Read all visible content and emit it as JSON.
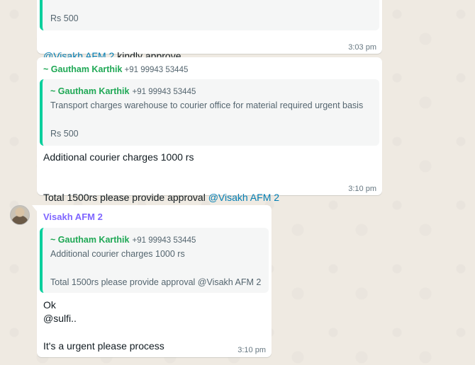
{
  "chat": {
    "msg1": {
      "quote_amount": "Rs 500",
      "mention": "@Visakh AFM 2",
      "text": " kindly approve",
      "time": "3:03 pm"
    },
    "msg2": {
      "sender_name": "~ Gautham Karthik",
      "sender_phone": "+91 99943 53445",
      "quote_author": "~ Gautham Karthik",
      "quote_phone": "+91 99943 53445",
      "quote_text": "Transport charges warehouse to courier office for material required urgent basis",
      "quote_amount": "Rs 500",
      "line1": "Additional courier charges 1000 rs",
      "line2": "Total 1500rs please provide approval ",
      "mention": "@Visakh AFM 2",
      "time": "3:10 pm"
    },
    "msg3": {
      "sender_name": "Visakh AFM 2",
      "quote_author": "~ Gautham Karthik",
      "quote_phone": "+91 99943 53445",
      "quote_line1": "Additional courier charges 1000 rs",
      "quote_line2": "Total 1500rs please provide approval @Visakh AFM 2",
      "line1": "Ok",
      "line2": "@sulfi..",
      "line3": "It's a urgent please process",
      "time": "3:10 pm"
    }
  },
  "colors": {
    "background": "#efeae2",
    "quote_bar": "#06cf9c",
    "author_green": "#1fa855",
    "mention_blue": "#027eb5",
    "visakh_purple": "#7f66ff"
  }
}
